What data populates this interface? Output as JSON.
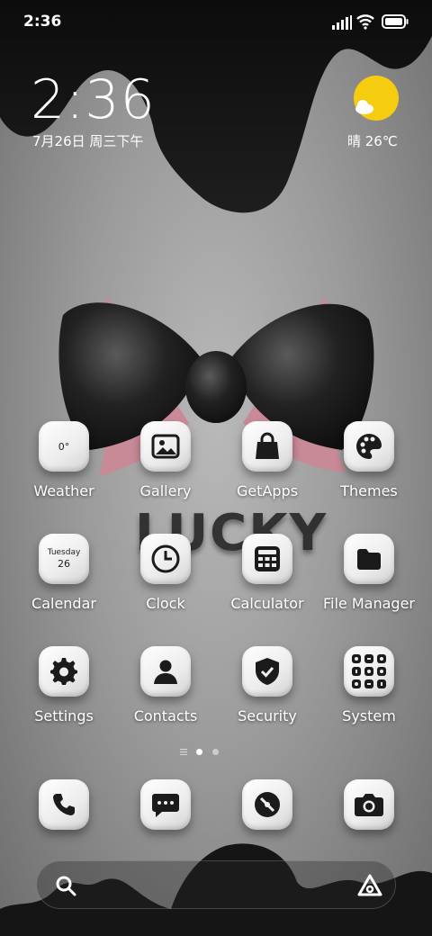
{
  "status_bar": {
    "time": "2:36"
  },
  "clock_widget": {
    "time": "2:36",
    "date": "7月26日 周三下午"
  },
  "weather_widget": {
    "temperature": "晴 26℃"
  },
  "wallpaper": {
    "text": "LUCKY"
  },
  "apps": [
    {
      "label": "Weather",
      "icon": "weather-icon",
      "tile_text": "0°"
    },
    {
      "label": "Gallery",
      "icon": "gallery-icon"
    },
    {
      "label": "GetApps",
      "icon": "shopping-bag-icon"
    },
    {
      "label": "Themes",
      "icon": "palette-icon"
    },
    {
      "label": "Calendar",
      "icon": "calendar-icon",
      "tile_day": "Tuesday",
      "tile_date": "26"
    },
    {
      "label": "Clock",
      "icon": "clock-icon"
    },
    {
      "label": "Calculator",
      "icon": "calculator-icon"
    },
    {
      "label": "File Manager",
      "icon": "folder-icon"
    },
    {
      "label": "Settings",
      "icon": "gear-icon"
    },
    {
      "label": "Contacts",
      "icon": "person-icon"
    },
    {
      "label": "Security",
      "icon": "shield-check-icon"
    },
    {
      "label": "System",
      "icon": "system-folder-icon"
    }
  ],
  "dock": [
    {
      "icon": "phone-icon"
    },
    {
      "icon": "message-icon"
    },
    {
      "icon": "browser-icon"
    },
    {
      "icon": "camera-icon"
    }
  ],
  "page_indicator": {
    "current_page": 1,
    "page_count": 2
  },
  "colors": {
    "sun": "#f6cc11",
    "tile": "#f1f1f1",
    "icon": "#1b1b1b",
    "bow_pink": "#c98a97"
  }
}
